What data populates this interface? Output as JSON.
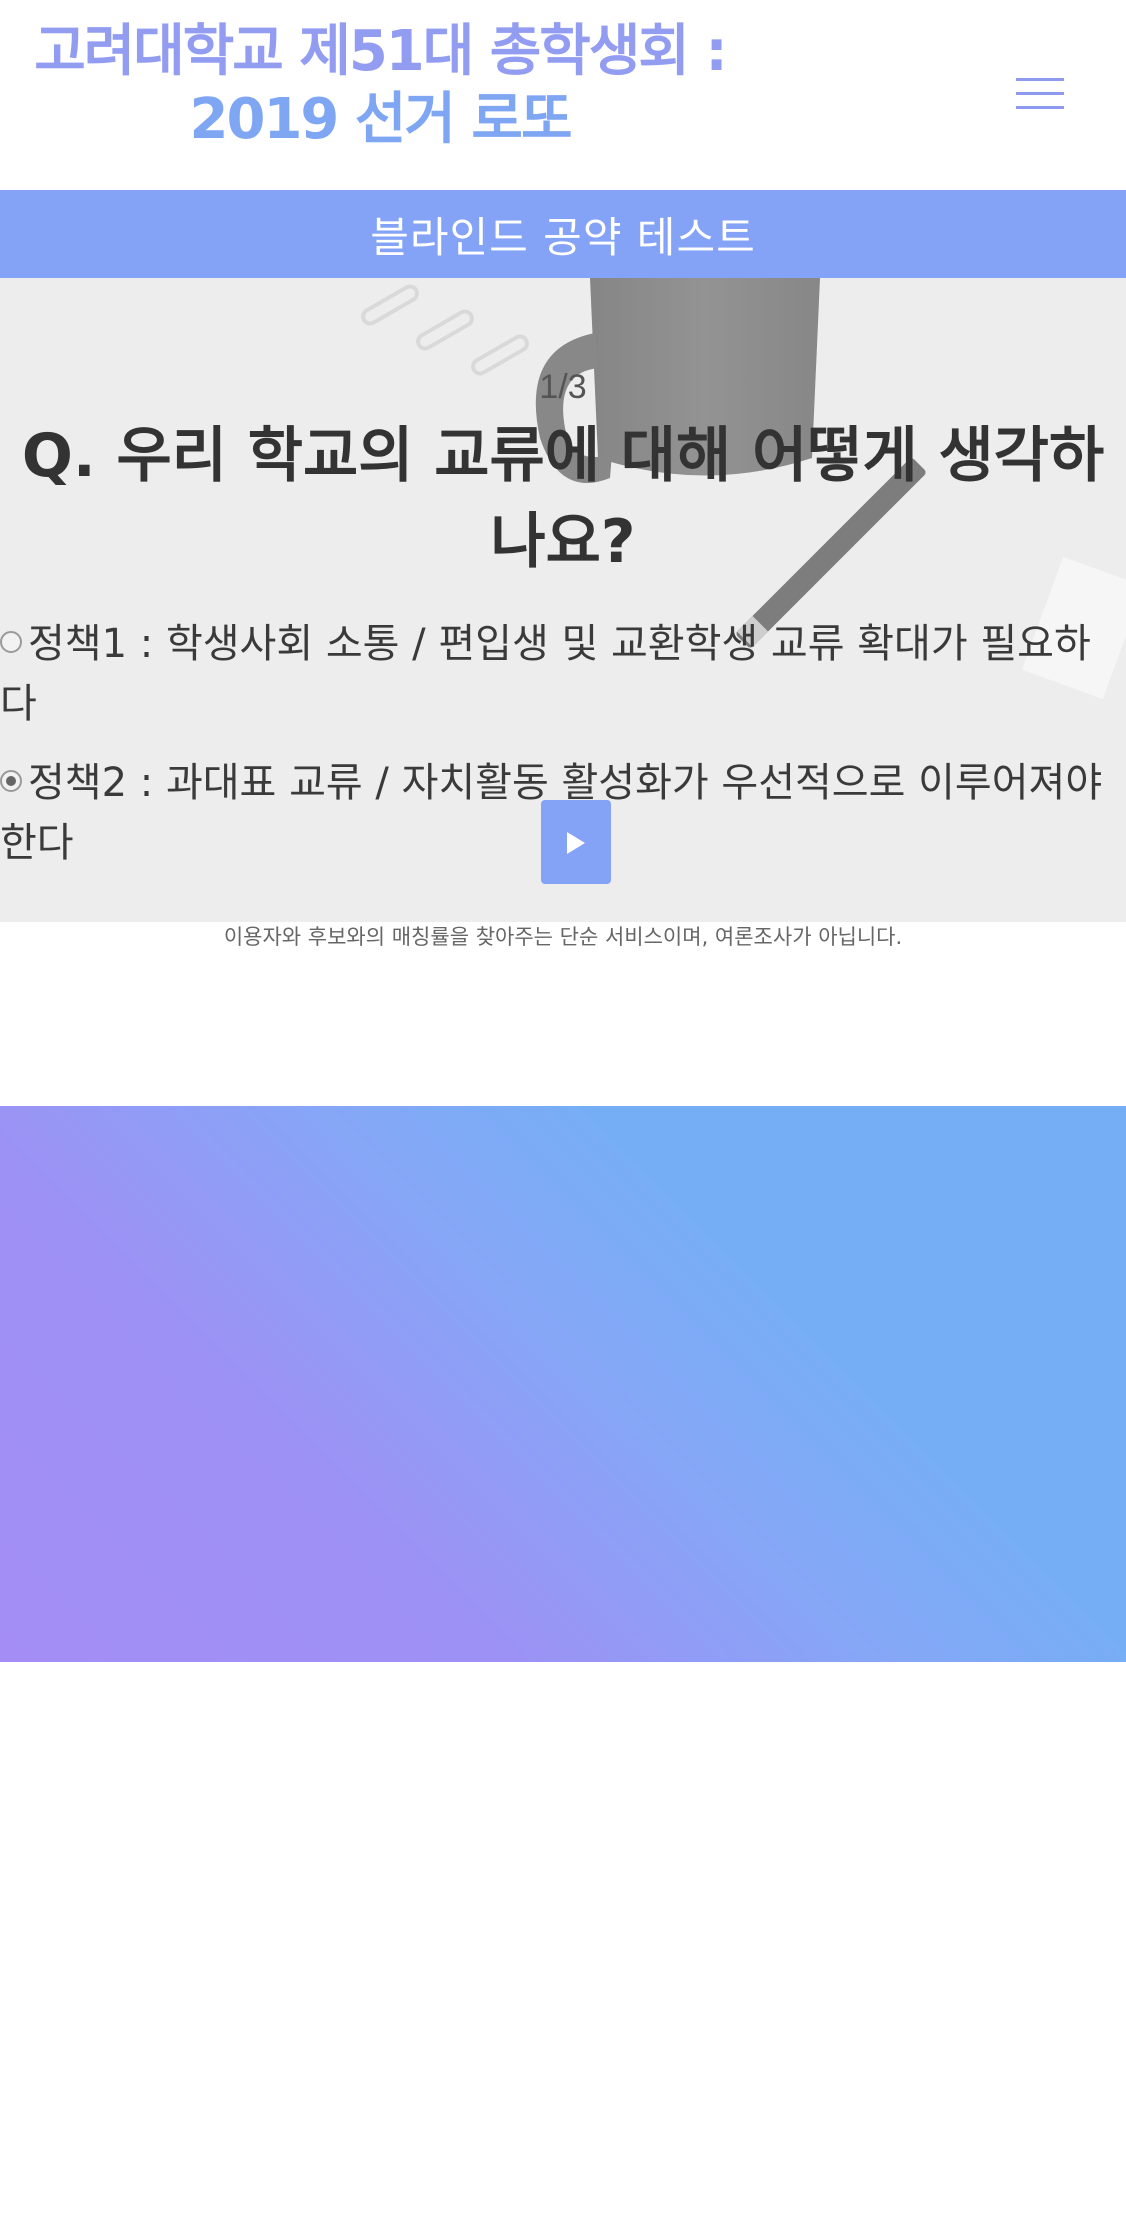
{
  "header": {
    "title_line1": "고려대학교 제51대 총학생회 :",
    "title_line2": "2019 선거 로또",
    "menu_icon": "hamburger-menu-icon"
  },
  "banner": {
    "title": "블라인드 공약 테스트"
  },
  "quiz": {
    "progress": "1/3",
    "question": "Q. 우리 학교의 교류에 대해 어떻게 생각하나요?",
    "options": [
      {
        "label": "정책1 : 학생사회 소통 / 편입생 및 교환학생 교류 확대가 필요하다",
        "selected": false
      },
      {
        "label": "정책2 : 과대표 교류 / 자치활동 활성화가 우선적으로 이루어져야 한다",
        "selected": true
      }
    ],
    "next_icon": "play-icon"
  },
  "disclaimer": "이용자와 후보와의 매칭률을 찾아주는 단순 서비스이며, 여론조사가 아닙니다.",
  "colors": {
    "accent": "#84a3f6",
    "title_purple": "#929cf1",
    "gradient_start": "#a48ef5",
    "gradient_end": "#76aef5"
  }
}
